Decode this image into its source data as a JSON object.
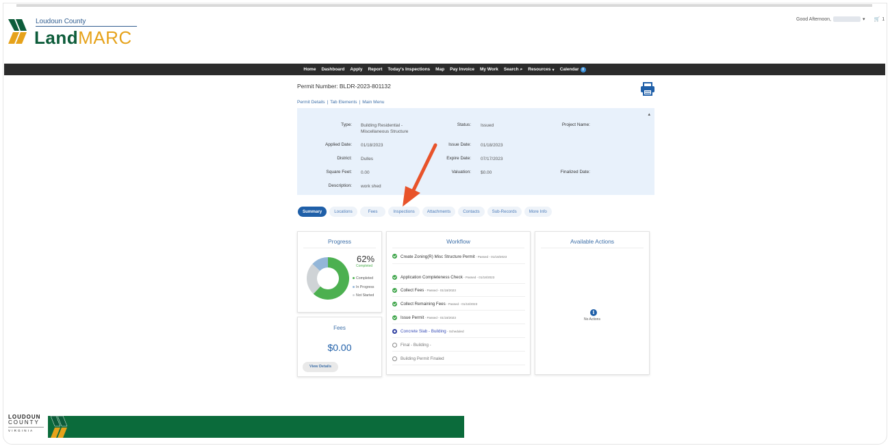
{
  "header": {
    "county": "Loudoun County",
    "brand_part1": "Land",
    "brand_part2": "MARC",
    "greeting": "Good Afternoon,",
    "cart_count": "1"
  },
  "nav": {
    "items": [
      "Home",
      "Dashboard",
      "Apply",
      "Report",
      "Today's Inspections",
      "Map",
      "Pay Invoice",
      "My Work",
      "Search",
      "Resources",
      "Calendar"
    ],
    "calendar_badge": "0"
  },
  "permit": {
    "title": "Permit Number: BLDR-2023-801132",
    "links": [
      "Permit Details",
      "Tab Elements",
      "Main Menu"
    ],
    "fields": {
      "type_label": "Type:",
      "type_value": "Building Residential - Miscellaneous Structure",
      "status_label": "Status:",
      "status_value": "Issued",
      "project_label": "Project Name:",
      "project_value": "",
      "applied_label": "Applied Date:",
      "applied_value": "01/18/2023",
      "issue_label": "Issue Date:",
      "issue_value": "01/18/2023",
      "district_label": "District:",
      "district_value": "Dulles",
      "expire_label": "Expire Date:",
      "expire_value": "07/17/2023",
      "sqft_label": "Square Feet:",
      "sqft_value": "0.00",
      "valuation_label": "Valuation:",
      "valuation_value": "$0.00",
      "finalized_label": "Finalized Date:",
      "finalized_value": "",
      "desc_label": "Description:",
      "desc_value": "work shed"
    }
  },
  "tabs": [
    "Summary",
    "Locations",
    "Fees",
    "Inspections",
    "Attachments",
    "Contacts",
    "Sub-Records",
    "More Info"
  ],
  "progress": {
    "title": "Progress",
    "percent_text": "62%",
    "percent_caption": "Completed",
    "completed_fraction": 0.62,
    "in_progress_fraction": 0.13,
    "not_started_fraction": 0.25,
    "legend": [
      "Completed",
      "In Progress",
      "Not Started"
    ],
    "colors": {
      "completed": "#4cb050",
      "in_progress": "#93b6d8",
      "not_started": "#cfd3d6"
    }
  },
  "fees": {
    "title": "Fees",
    "amount": "$0.00",
    "button": "View Details"
  },
  "workflow": {
    "title": "Workflow",
    "steps": [
      {
        "name": "Create Zoning(R) Misc Structure Permit",
        "status": " - Passed - 01/18/2023",
        "state": "done"
      },
      {
        "name": "Application Completeness Check",
        "status": " - Passed - 01/18/2023",
        "state": "done"
      },
      {
        "name": "Collect Fees",
        "status": " - Passed - 01/18/2023",
        "state": "done"
      },
      {
        "name": "Collect Remaining Fees",
        "status": " - Passed - 01/18/2023",
        "state": "done"
      },
      {
        "name": "Issue Permit",
        "status": " - Passed - 01/18/2023",
        "state": "done"
      },
      {
        "name": "Concrete Slab - Building",
        "status": " - Scheduled",
        "state": "scheduled"
      },
      {
        "name": "Final - Building -",
        "status": "",
        "state": "open"
      },
      {
        "name": "Building Permit Finaled",
        "status": "",
        "state": "open"
      }
    ]
  },
  "actions": {
    "title": "Available Actions",
    "empty_text": "No Actions"
  },
  "footer": {
    "line1": "LOUDOUN",
    "line2": "COUNTY",
    "line3": "VIRGINIA"
  }
}
